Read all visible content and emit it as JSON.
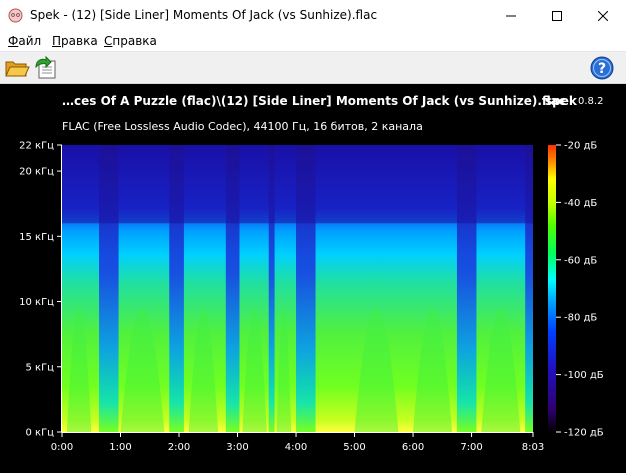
{
  "window": {
    "title": "Spek - (12) [Side Liner] Moments Of Jack (vs Sunhize).flac",
    "icons": {
      "app": "spek-app-icon",
      "minimize": "minimize-icon",
      "maximize": "maximize-icon",
      "close": "close-icon"
    }
  },
  "menu": {
    "items": [
      {
        "label": "Файл",
        "accel": "Ф",
        "rest": "айл"
      },
      {
        "label": "Правка",
        "accel": "П",
        "rest": "равка"
      },
      {
        "label": "Справка",
        "accel": "С",
        "rest": "правка"
      }
    ]
  },
  "toolbar": {
    "icons": {
      "open": "folder-open-icon",
      "save": "save-image-icon",
      "help": "help-icon"
    }
  },
  "spectrogram": {
    "file_label": "…ces Of A Puzzle (flac)\\(12) [Side Liner] Moments Of Jack (vs Sunhize).flac",
    "app_name": "spek",
    "app_version": "0.8.2",
    "info": "FLAC (Free Lossless Audio Codec), 44100 Гц, 16 битов, 2 канала",
    "colors": {
      "background": "#000000",
      "scale": [
        "#ffffff",
        "#ffff00",
        "#ff3000",
        "#ff9000",
        "#c8ff00",
        "#50ff00",
        "#00ff60",
        "#00ffff",
        "#00a0ff",
        "#0040ff",
        "#2010c0",
        "#300070",
        "#000000"
      ]
    }
  },
  "chart_data": {
    "type": "heatmap",
    "xlabel": "",
    "ylabel": "",
    "x_ticks": [
      "0:00",
      "1:00",
      "2:00",
      "3:00",
      "4:00",
      "5:00",
      "6:00",
      "7:00",
      "8:03"
    ],
    "x_tick_seconds": [
      0,
      60,
      120,
      180,
      240,
      300,
      360,
      420,
      483
    ],
    "xlim_seconds": [
      0,
      483
    ],
    "y_ticks": [
      "0 кГц",
      "5 кГц",
      "10 кГц",
      "15 кГц",
      "20 кГц",
      "22 кГц"
    ],
    "y_tick_khz": [
      0,
      5,
      10,
      15,
      20,
      22
    ],
    "ylim_khz": [
      0,
      22
    ],
    "colorbar_ticks": [
      "-20 дБ",
      "-40 дБ",
      "-60 дБ",
      "-80 дБ",
      "-100 дБ",
      "-120 дБ"
    ],
    "colorbar_db": [
      -20,
      -40,
      -60,
      -80,
      -100,
      -120
    ],
    "colorbar_range_db": [
      -120,
      -20
    ],
    "high_frequency_cutoff_khz": 16,
    "loud_segments_seconds": [
      [
        5,
        30
      ],
      [
        60,
        105
      ],
      [
        130,
        160
      ],
      [
        185,
        210
      ],
      [
        220,
        235
      ],
      [
        300,
        345
      ],
      [
        360,
        400
      ],
      [
        430,
        470
      ]
    ],
    "quiet_segments_seconds": [
      [
        38,
        58
      ],
      [
        110,
        125
      ],
      [
        168,
        182
      ],
      [
        212,
        218
      ],
      [
        240,
        260
      ],
      [
        405,
        425
      ],
      [
        475,
        483
      ]
    ]
  }
}
